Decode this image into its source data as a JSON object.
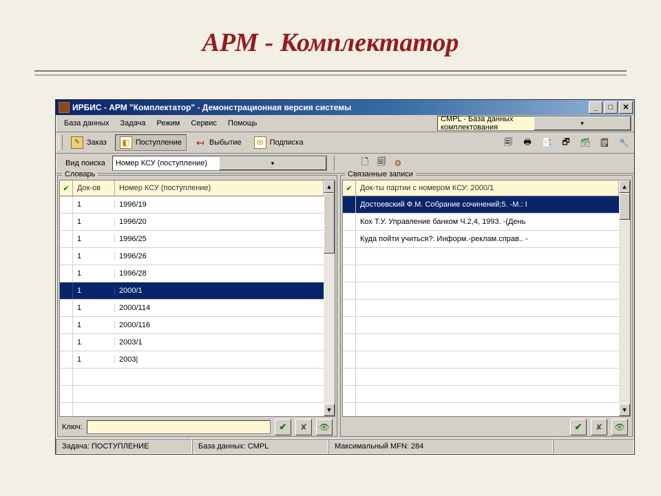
{
  "slide": {
    "title": "АРМ - Комплектатор"
  },
  "window": {
    "title": "ИРБИС - АРМ \"Комплектатор\" - Демонстрационная версия системы"
  },
  "menu": {
    "db": "База данных",
    "task": "Задача",
    "mode": "Режим",
    "service": "Сервис",
    "help": "Помощь",
    "db_combo": "CMPL - База данных комплектования"
  },
  "toolbar": {
    "order": "Заказ",
    "incoming": "Поступление",
    "disposal": "Выбытие",
    "subscription": "Подписка"
  },
  "search": {
    "label": "Вид поиска",
    "value": "Номер КСУ (поступление)"
  },
  "dict": {
    "title": "Словарь",
    "col_count": "Док-ов",
    "col_main": "Номер КСУ (поступление)",
    "rows": [
      {
        "cnt": "1",
        "val": "1996/19"
      },
      {
        "cnt": "1",
        "val": "1996/20"
      },
      {
        "cnt": "1",
        "val": "1996/25"
      },
      {
        "cnt": "1",
        "val": "1996/26"
      },
      {
        "cnt": "1",
        "val": "1996/28"
      },
      {
        "cnt": "1",
        "val": "2000/1"
      },
      {
        "cnt": "1",
        "val": "2000/114"
      },
      {
        "cnt": "1",
        "val": "2000/116"
      },
      {
        "cnt": "1",
        "val": "2003/1"
      },
      {
        "cnt": "1",
        "val": "2003|"
      }
    ],
    "selected_index": 5
  },
  "related": {
    "title": "Связанные записи",
    "col_main": "Док-ты партии с номером КСУ: 2000/1",
    "rows": [
      {
        "val": "Достоевский Ф.М. Собрание сочинений;5. -М.: I"
      },
      {
        "val": "Кох Т.У. Управление банком Ч.2,4, 1993. -(День"
      },
      {
        "val": "Куда пойти учиться?: Информ.-реклам.справ.. -"
      }
    ],
    "selected_index": 0
  },
  "keybar": {
    "label": "Ключ:"
  },
  "status": {
    "task": "Задача: ПОСТУПЛЕНИЕ",
    "db": "База данных: CMPL",
    "mfn": "Максимальный MFN: 284"
  }
}
